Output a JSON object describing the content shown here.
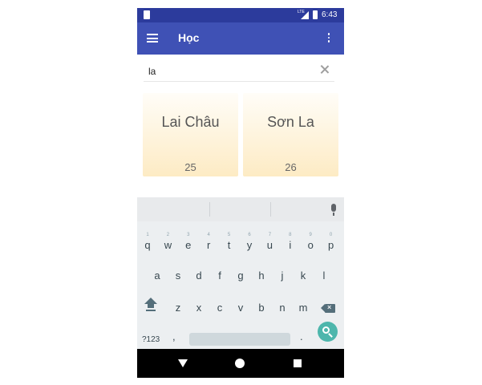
{
  "status_bar": {
    "network": "LTE",
    "time": "6:43"
  },
  "app_bar": {
    "title": "Học",
    "menu_icon": "hamburger-menu-icon",
    "overflow_icon": "more-vert-icon"
  },
  "search": {
    "value": "la",
    "clear_icon": "close-icon"
  },
  "cards": [
    {
      "name": "Lai Châu",
      "count": "25"
    },
    {
      "name": "Sơn La",
      "count": "26"
    }
  ],
  "colors": {
    "status_bar": "#2c3b9c",
    "app_bar": "#3f51b5",
    "card_gradient_end": "#fdebc4",
    "search_key": "#4db6ac"
  },
  "keyboard": {
    "row1": [
      {
        "k": "q",
        "h": "1"
      },
      {
        "k": "w",
        "h": "2"
      },
      {
        "k": "e",
        "h": "3"
      },
      {
        "k": "r",
        "h": "4"
      },
      {
        "k": "t",
        "h": "5"
      },
      {
        "k": "y",
        "h": "6"
      },
      {
        "k": "u",
        "h": "7"
      },
      {
        "k": "i",
        "h": "8"
      },
      {
        "k": "o",
        "h": "9"
      },
      {
        "k": "p",
        "h": "0"
      }
    ],
    "row2": [
      "a",
      "s",
      "d",
      "f",
      "g",
      "h",
      "j",
      "k",
      "l"
    ],
    "row3": [
      "z",
      "x",
      "c",
      "v",
      "b",
      "n",
      "m"
    ],
    "symbols": "?123",
    "comma": ",",
    "period": "."
  }
}
